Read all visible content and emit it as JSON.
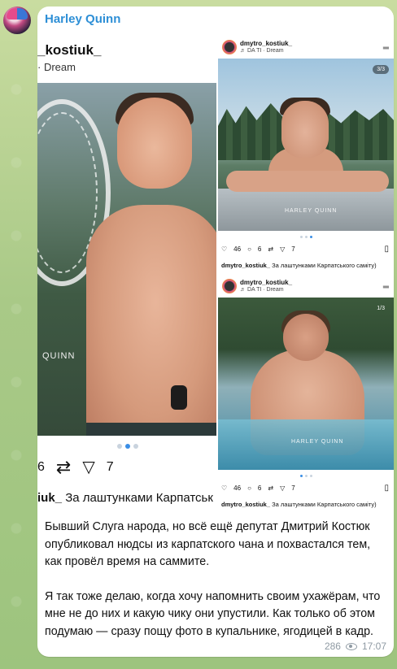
{
  "chat": {
    "sender_name": "Harley Quinn",
    "message_paragraphs": [
      "Бывший Слуга народа, но всё ещё депутат Дмитрий Костюк опубликовал нюдсы из карпатского чана и похвастался тем, как провёл время на саммите.",
      "Я так тоже делаю, когда хочу напомнить своим ухажёрам, что мне не до них и какую чику они упустили. Как только об этом подумаю — сразу пощу фото в купальнике, ягодицей в кадр."
    ],
    "views": "286",
    "time": "17:07"
  },
  "left_post": {
    "username": "_kostiuk_",
    "song": "· Dream",
    "watermark": "QUINN",
    "likes_partial": "6",
    "shares": "7",
    "caption_user": "iuk_",
    "caption_text": "За лаштунками Карпатськ"
  },
  "right_posts": [
    {
      "username": "dmytro_kostiuk_",
      "song": "♬ DA TI · Dream",
      "counter": "3/3",
      "watermark": "HARLEY QUINN",
      "likes": "46",
      "comments": "6",
      "shares": "7",
      "caption_user": "dmytro_kostiuk_",
      "caption_text": "За лаштунками Карпатського саміту)"
    },
    {
      "username": "dmytro_kostiuk_",
      "song": "♬ DA TI · Dream",
      "counter": "1/3",
      "watermark": "HARLEY QUINN",
      "likes": "46",
      "comments": "6",
      "shares": "7",
      "caption_user": "dmytro_kostiuk_",
      "caption_text": "За лаштунками Карпатського саміту)"
    }
  ],
  "colors": {
    "sender": "#2e8fd6",
    "carousel_active": "#3a8ee6"
  }
}
